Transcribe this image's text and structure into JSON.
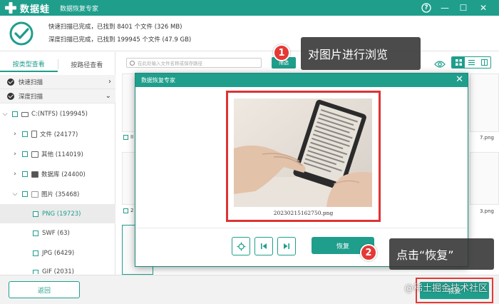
{
  "titlebar": {
    "app_name": "数据蛙",
    "subtitle": "数据恢复专家",
    "icons": {
      "logo": "plus-logo-icon",
      "help": "help-icon",
      "minimize": "minimize-icon",
      "restore": "restore-icon",
      "close": "close-icon"
    },
    "glyphs": {
      "help": "?",
      "minimize": "—",
      "restore": "☐",
      "close": "✕"
    }
  },
  "status": {
    "quick_scan": "快速扫描已完成，已找到 8401 个文件 (326 MB)",
    "deep_scan": "深度扫描已完成，已找到 199945 个文件 (47.9 GB)"
  },
  "left_panel": {
    "tabs": [
      {
        "label": "按类型查看",
        "active": true
      },
      {
        "label": "按路径查看",
        "active": false
      }
    ],
    "scan_modes": [
      {
        "label": "快速扫描",
        "chevron": "›"
      },
      {
        "label": "深度扫描",
        "chevron": "⌄"
      }
    ],
    "tree": [
      {
        "expander": "⌵",
        "label": "C:(NTFS) (199945)",
        "icon": "drive-icon"
      },
      {
        "expander": "›",
        "label": "文件 (24177)",
        "icon": "document-icon"
      },
      {
        "expander": "›",
        "label": "其他 (114019)",
        "icon": "folder-icon"
      },
      {
        "expander": "›",
        "label": "数据库 (24400)",
        "icon": "database-icon"
      },
      {
        "expander": "⌵",
        "label": "图片 (35468)",
        "icon": "image-icon"
      },
      {
        "expander": "",
        "label": "PNG (19723)",
        "selected": true
      },
      {
        "expander": "",
        "label": "SWF (63)"
      },
      {
        "expander": "",
        "label": "JPG (6429)"
      },
      {
        "expander": "",
        "label": "GIF (2031)"
      }
    ]
  },
  "toolbar": {
    "search_placeholder": "在此处输入文件名称或保存路径",
    "filter_label": "筛选"
  },
  "background_labels": {
    "left_top": "II",
    "right_top": "7.png",
    "left_mid": "2",
    "right_mid": "3.png"
  },
  "dialog": {
    "title": "数据恢复专家",
    "close_glyph": "✕",
    "file_name": "20230215162750.png",
    "recover_label": "恢复"
  },
  "bottom": {
    "back_label": "返回",
    "recover_label": "恢复"
  },
  "annotations": {
    "step1_badge": "1",
    "step1_text": "对图片进行浏览",
    "step2_badge": "2",
    "step2_text": "点击“恢复”"
  },
  "watermark": "@稀土掘金技术社区",
  "colors": {
    "brand": "#1f9e8c",
    "highlight": "#e53935"
  }
}
